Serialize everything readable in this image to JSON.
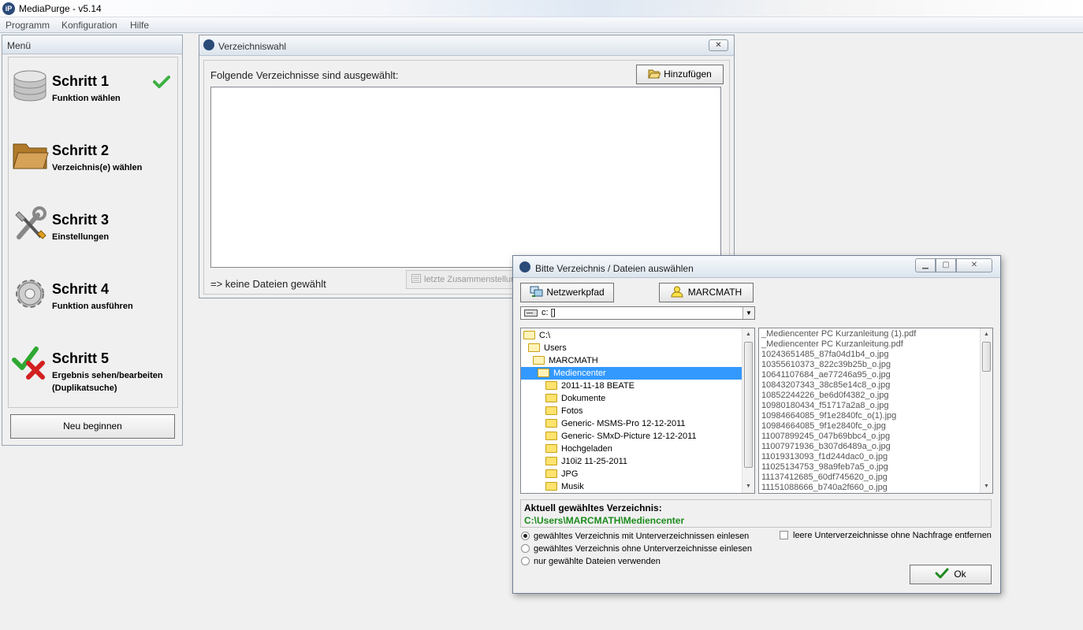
{
  "window": {
    "title": "MediaPurge - v5.14"
  },
  "menubar": {
    "items": [
      "Programm",
      "Konfiguration",
      "Hilfe"
    ]
  },
  "menu_panel": {
    "header": "Menü",
    "steps": [
      {
        "title": "Schritt 1",
        "subtitle": "Funktion wählen",
        "completed": true
      },
      {
        "title": "Schritt 2",
        "subtitle": "Verzeichnis(e) wählen"
      },
      {
        "title": "Schritt 3",
        "subtitle": "Einstellungen"
      },
      {
        "title": "Schritt 4",
        "subtitle": "Funktion ausführen"
      },
      {
        "title": "Schritt 5",
        "subtitle": "Ergebnis sehen/bearbeiten",
        "subtitle2": "(Duplikatsuche)"
      }
    ],
    "restart_label": "Neu beginnen"
  },
  "verzeichniswahl": {
    "title": "Verzeichniswahl",
    "close_label": "✕",
    "label": "Folgende Verzeichnisse sind ausgewählt:",
    "add_button": "Hinzufügen",
    "status": "=> keine Dateien gewählt",
    "last_button": "letzte Zusammenstellung"
  },
  "dialog": {
    "title": "Bitte Verzeichnis / Dateien auswählen",
    "network_button": "Netzwerkpfad",
    "user_button": "MARCMATH",
    "drive": "c: []",
    "tree": [
      {
        "label": "C:\\",
        "level": 0
      },
      {
        "label": "Users",
        "level": 1
      },
      {
        "label": "MARCMATH",
        "level": 2
      },
      {
        "label": "Mediencenter",
        "level": 3,
        "selected": true
      },
      {
        "label": "2011-11-18 BEATE",
        "level": 4
      },
      {
        "label": "Dokumente",
        "level": 4
      },
      {
        "label": "Fotos",
        "level": 4
      },
      {
        "label": "Generic- MSMS-Pro 12-12-2011",
        "level": 4
      },
      {
        "label": "Generic- SMxD-Picture 12-12-2011",
        "level": 4
      },
      {
        "label": "Hochgeladen",
        "level": 4
      },
      {
        "label": "J10i2 11-25-2011",
        "level": 4
      },
      {
        "label": "JPG",
        "level": 4
      },
      {
        "label": "Musik",
        "level": 4
      }
    ],
    "files": [
      "_Mediencenter PC Kurzanleitung (1).pdf",
      "_Mediencenter PC Kurzanleitung.pdf",
      "10243651485_87fa04d1b4_o.jpg",
      "10355610373_822c39b25b_o.jpg",
      "10641107684_ae77246a95_o.jpg",
      "10843207343_38c85e14c8_o.jpg",
      "10852244226_be6d0f4382_o.jpg",
      "10980180434_f51717a2a8_o.jpg",
      "10984664085_9f1e2840fc_o(1).jpg",
      "10984664085_9f1e2840fc_o.jpg",
      "11007899245_047b69bbc4_o.jpg",
      "11007971936_b307d6489a_o.jpg",
      "11019313093_f1d244dac0_o.jpg",
      "11025134753_98a9feb7a5_o.jpg",
      "11137412685_60df745620_o.jpg",
      "11151088666_b740a2f660_o.jpg"
    ],
    "current_label": "Aktuell gewähltes Verzeichnis:",
    "current_path": "C:\\Users\\MARCMATH\\Mediencenter",
    "radios": [
      {
        "label": "gewähltes Verzeichnis mit Unterverzeichnissen einlesen",
        "checked": true
      },
      {
        "label": "gewähltes Verzeichnis ohne Unterverzeichnisse einlesen",
        "checked": false
      },
      {
        "label": "nur gewählte Dateien verwenden",
        "checked": false
      }
    ],
    "checkbox_label": "leere Unterverzeichnisse ohne Nachfrage entfernen",
    "ok_label": "Ok"
  },
  "colors": {
    "accent_selection": "#3399ff",
    "path_green": "#1d8b1d"
  }
}
